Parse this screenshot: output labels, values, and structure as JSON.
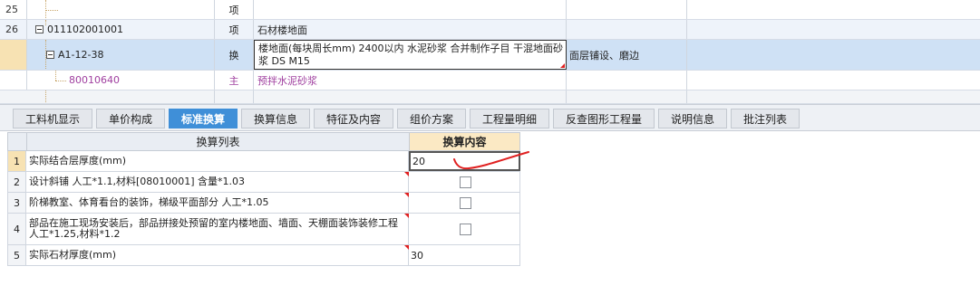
{
  "top_grid": {
    "rows": [
      {
        "rownum": "25",
        "code": "",
        "unit": "项",
        "name": "",
        "feature": ""
      },
      {
        "rownum": "26",
        "code": "011102001001",
        "unit": "项",
        "name": "石材楼地面",
        "feature": ""
      },
      {
        "rownum": "",
        "code": "A1-12-38",
        "unit": "换",
        "name": "楼地面(每块周长mm) 2400以内 水泥砂浆  合并制作子目 干混地面砂浆 DS M15",
        "feature": "面层铺设、磨边"
      },
      {
        "rownum": "",
        "code": "80010640",
        "unit": "主",
        "name": "预拌水泥砂浆",
        "feature": ""
      }
    ]
  },
  "tabs": [
    {
      "label": "工料机显示"
    },
    {
      "label": "单价构成"
    },
    {
      "label": "标准换算"
    },
    {
      "label": "换算信息"
    },
    {
      "label": "特征及内容"
    },
    {
      "label": "组价方案"
    },
    {
      "label": "工程量明细"
    },
    {
      "label": "反查图形工程量"
    },
    {
      "label": "说明信息"
    },
    {
      "label": "批注列表"
    }
  ],
  "active_tab": "标准换算",
  "conversion_table": {
    "headers": {
      "list": "换算列表",
      "content": "换算内容"
    },
    "rows": [
      {
        "index": "1",
        "text": "实际结合层厚度(mm)",
        "value": "20"
      },
      {
        "index": "2",
        "text": "设计斜铺 人工*1.1,材料[08010001] 含量*1.03",
        "checked": false
      },
      {
        "index": "3",
        "text": "阶梯教室、体育看台的装饰，梯级平面部分 人工*1.05",
        "checked": false
      },
      {
        "index": "4",
        "text": "部品在施工现场安装后，部品拼接处预留的室内楼地面、墙面、天棚面装饰装修工程 人工*1.25,材料*1.2",
        "checked": false
      },
      {
        "index": "5",
        "text": "实际石材厚度(mm)",
        "value": "30"
      }
    ]
  },
  "colors": {
    "active_tab": "#3f8fd8",
    "selected_row": "#cfe1f5",
    "main_material_text": "#a040a0",
    "annotation": "#e02020"
  }
}
